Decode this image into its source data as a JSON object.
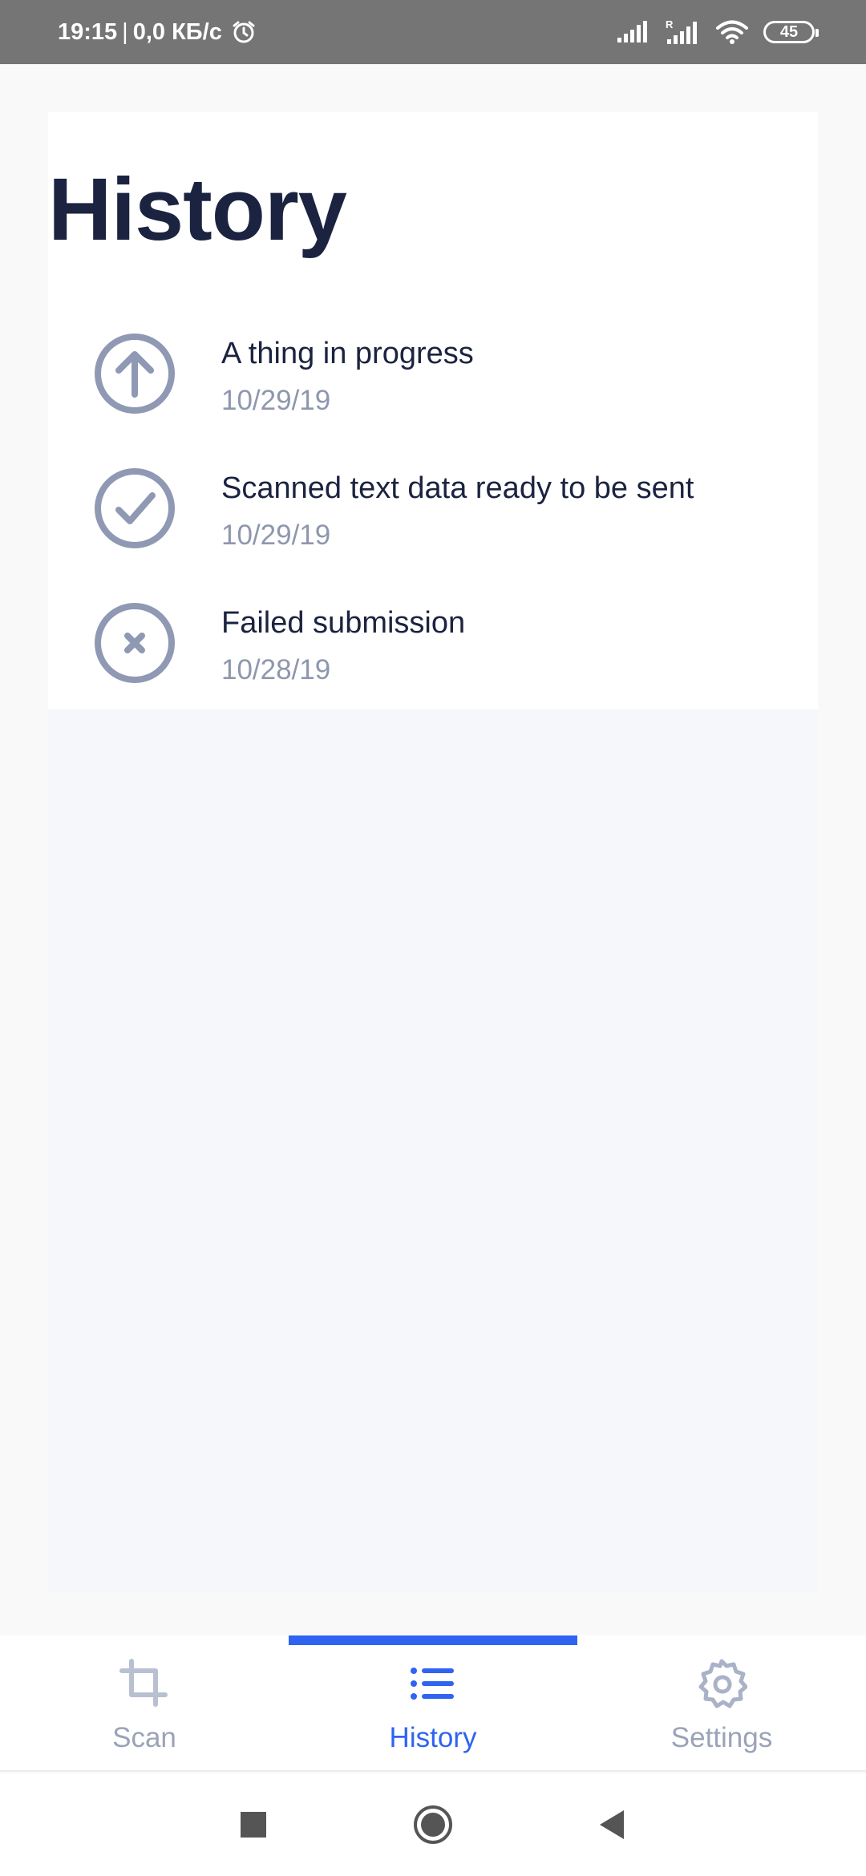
{
  "status_bar": {
    "time": "19:15",
    "separator": "|",
    "network_speed": "0,0 КБ/с",
    "battery": "45",
    "icons": [
      "alarm-icon",
      "signal-icon",
      "signal-roaming-icon",
      "wifi-icon",
      "battery-icon"
    ]
  },
  "page": {
    "title": "History"
  },
  "history": [
    {
      "title": "A thing in progress",
      "date": "10/29/19",
      "icon": "upload-arrow-icon"
    },
    {
      "title": "Scanned text data ready to be sent",
      "date": "10/29/19",
      "icon": "check-circle-icon"
    },
    {
      "title": "Failed submission",
      "date": "10/28/19",
      "icon": "cancel-circle-icon"
    }
  ],
  "bottom_nav": {
    "items": [
      {
        "label": "Scan",
        "icon": "crop-icon",
        "active": false
      },
      {
        "label": "History",
        "icon": "list-icon",
        "active": true
      },
      {
        "label": "Settings",
        "icon": "gear-icon",
        "active": false
      }
    ]
  },
  "colors": {
    "accent": "#2f63f2",
    "title_text": "#1b2340",
    "secondary_text": "#8e97ad",
    "icon_gray": "#8f99b3",
    "status_bar": "#757575"
  }
}
